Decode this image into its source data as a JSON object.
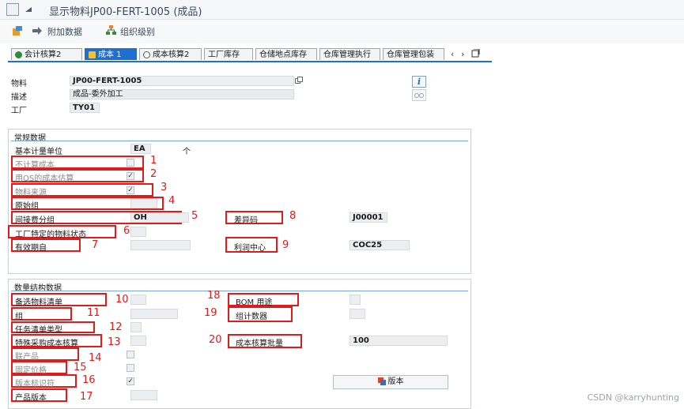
{
  "window": {
    "title": "显示物料JP00-FERT-1005 (成品)"
  },
  "toolbar": {
    "additional_data": "附加数据",
    "org_levels": "组织级别"
  },
  "tabs": [
    {
      "label": "会计核算2",
      "active": false
    },
    {
      "label": "成本 1",
      "active": true
    },
    {
      "label": "成本核算2",
      "active": false
    },
    {
      "label": "工厂库存",
      "active": false
    },
    {
      "label": "仓储地点库存",
      "active": false
    },
    {
      "label": "仓库管理执行",
      "active": false
    },
    {
      "label": "仓库管理包装",
      "active": false
    }
  ],
  "header": {
    "material_label": "物料",
    "material_value": "JP00-FERT-1005",
    "desc_label": "描述",
    "desc_value": "成品-委外加工",
    "plant_label": "工厂",
    "plant_value": "TY01"
  },
  "general": {
    "title": "常规数据",
    "base_uom_label": "基本计量单位",
    "base_uom_value": "EA",
    "base_uom_text": "个",
    "no_costing": "不计算成本",
    "qs_costing": "用QS的成本估算",
    "material_origin": "物料来源",
    "origin_group": "原始组",
    "overhead_group": "间接费分组",
    "overhead_value": "OH",
    "variance_key": "差异码",
    "variance_value": "J00001",
    "plant_status": "工厂特定的物料状态",
    "valid_from": "有效期自",
    "profit_center": "利润中心",
    "profit_center_value": "COC25"
  },
  "qty": {
    "title": "数量结构数据",
    "alt_bom": "备选物料清单",
    "bom_usage": "BOM 用途",
    "group": "组",
    "group_counter": "组计数器",
    "task_list_type": "任务清单类型",
    "special_procurement": "特殊采购成本核算",
    "costing_lot_size": "成本核算批量",
    "costing_lot_size_value": "100",
    "coproduct": "联产品",
    "fixed_price": "固定价格",
    "version_indicator": "版本标识符",
    "production_version": "产品版本",
    "versions_button": "版本"
  },
  "annotations": [
    "1",
    "2",
    "3",
    "4",
    "5",
    "6",
    "7",
    "8",
    "9",
    "10",
    "11",
    "12",
    "13",
    "14",
    "15",
    "16",
    "17",
    "18",
    "19",
    "20"
  ],
  "watermark": "CSDN @karryhunting",
  "colors": {
    "accent": "#1f6fd1",
    "annotation": "#e01b1b"
  }
}
